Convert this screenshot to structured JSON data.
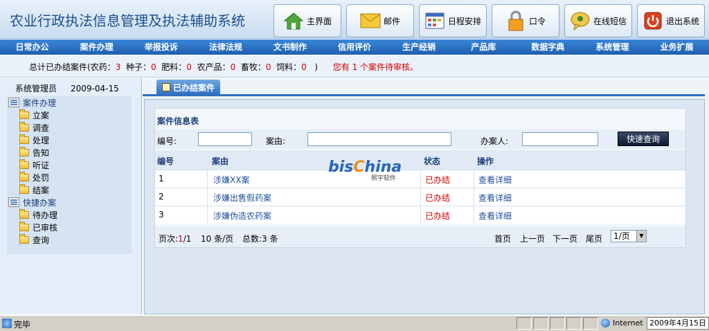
{
  "app": {
    "title": "农业行政执法信息管理及执法辅助系统"
  },
  "toolbar": {
    "buttons": [
      {
        "label": "主界面",
        "icon": "home-icon"
      },
      {
        "label": "邮件",
        "icon": "mail-icon"
      },
      {
        "label": "日程安排",
        "icon": "calendar-icon"
      },
      {
        "label": "口令",
        "icon": "lock-icon"
      },
      {
        "label": "在线短信",
        "icon": "chat-icon"
      },
      {
        "label": "退出系统",
        "icon": "power-icon"
      }
    ]
  },
  "nav": {
    "items": [
      "日常办公",
      "案件办理",
      "举报投诉",
      "法律法规",
      "文书制作",
      "信用评价",
      "生产经销",
      "产品库",
      "数据字典",
      "系统管理",
      "业务扩展"
    ]
  },
  "stats": {
    "prefix": "总计已办结案件(农药：",
    "pesticide": "3",
    "seed_label": "种子：",
    "seed": "0",
    "fertilizer_label": "肥料：",
    "fertilizer": "0",
    "produce_label": "农产品：",
    "produce": "0",
    "livestock_label": "畜牧：",
    "livestock": "0",
    "feed_label": "饲料：",
    "feed": "0",
    "suffix": ")",
    "pending_notice": "您有 1 个案件待审核。"
  },
  "sidebar": {
    "user": "系统管理员",
    "date": "2009-04-15",
    "groups": [
      {
        "label": "案件办理",
        "items": [
          "立案",
          "调查",
          "处理",
          "告知",
          "听证",
          "处罚",
          "结案"
        ]
      },
      {
        "label": "快捷办案",
        "items": [
          "待办理",
          "已审核",
          "查询"
        ]
      }
    ]
  },
  "main": {
    "tab_label": "已办结案件",
    "card_title": "案件信息表",
    "search": {
      "number_label": "编号:",
      "reason_label": "案由:",
      "handler_label": "办案人:",
      "button_label": "快速查询",
      "number_value": "",
      "reason_value": "",
      "handler_value": ""
    },
    "table": {
      "headers": [
        "编号",
        "案由",
        "状态",
        "操作"
      ],
      "rows": [
        {
          "id": "1",
          "reason": "涉嫌XX案",
          "status": "已办结",
          "action": "查看详细"
        },
        {
          "id": "2",
          "reason": "涉嫌出售假药案",
          "status": "已办结",
          "action": "查看详细"
        },
        {
          "id": "3",
          "reason": "涉嫌伪造农药案",
          "status": "已办结",
          "action": "查看详细"
        }
      ]
    },
    "pager": {
      "page_label": "页次:",
      "page_current": "1",
      "page_total": "/1",
      "per_page": "10 条/页",
      "total": "总数:3 条",
      "first": "首页",
      "prev": "上一页",
      "next": "下一页",
      "last": "尾页",
      "select_value": "1/页"
    }
  },
  "watermark": {
    "brand_a": "bis",
    "brand_b": "C",
    "brand_c": "hina",
    "sub": "熙宇软件"
  },
  "statusbar": {
    "text": "完毕",
    "zone": "Internet",
    "date": "2009年4月15日"
  },
  "colors": {
    "nav": "#1e5fb0",
    "accent": "#2d6fbf",
    "status_red": "#d10000",
    "link": "#1d4f9c"
  }
}
